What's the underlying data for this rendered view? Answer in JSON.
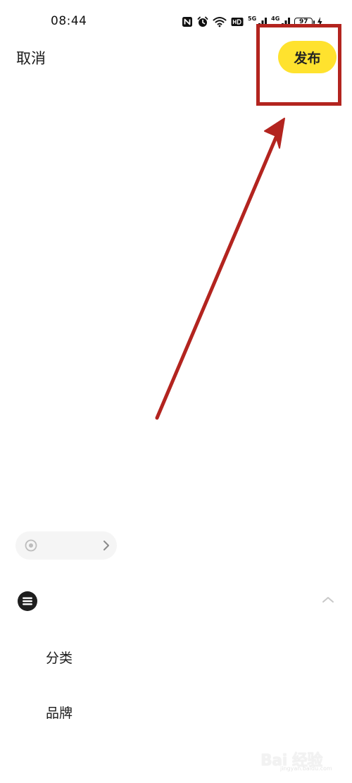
{
  "status_bar": {
    "time": "08:44",
    "net_5g": "5G",
    "net_4g": "4G",
    "battery": "97"
  },
  "header": {
    "cancel_label": "取消",
    "publish_label": "发布"
  },
  "options": {
    "category_label": "分类",
    "brand_label": "品牌"
  },
  "watermark": {
    "text": "Bai 经验",
    "url": "jingyan.baidu.com"
  },
  "colors": {
    "publish_button_bg": "#ffe22e",
    "annotation_red": "#b3241f",
    "chip_bg": "#f5f5f5"
  },
  "icons": {
    "nfc": "nfc-icon",
    "alarm": "alarm-icon",
    "wifi": "wifi-icon",
    "hd": "hd-icon",
    "signal": "signal-icon",
    "charging": "charging-icon",
    "location": "location-icon",
    "chevron": "chevron-right-icon",
    "options": "options-list-icon",
    "collapse": "chevron-up-icon"
  }
}
